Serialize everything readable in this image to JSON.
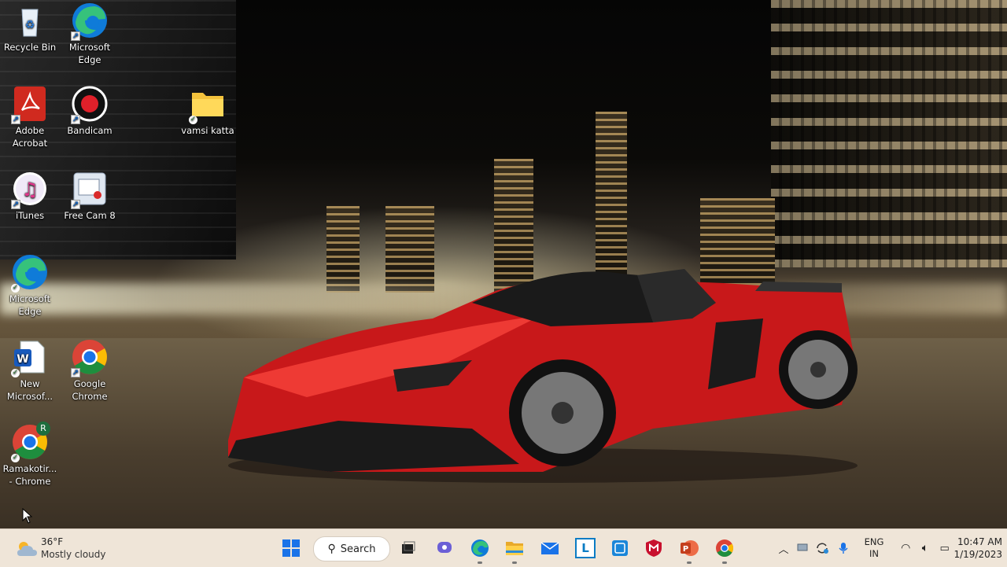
{
  "desktop": {
    "icons": [
      {
        "label": "Recycle Bin"
      },
      {
        "label": "Microsoft Edge"
      },
      {
        "label": "Adobe Acrobat"
      },
      {
        "label": "Bandicam"
      },
      {
        "label": "vamsi katta"
      },
      {
        "label": "iTunes"
      },
      {
        "label": "Free Cam 8"
      },
      {
        "label": "Microsoft Edge"
      },
      {
        "label": "New Microsof..."
      },
      {
        "label": "Google Chrome"
      },
      {
        "label": "Ramakotir... - Chrome"
      }
    ],
    "chrome_profile_badge": "R"
  },
  "taskbar": {
    "weather": {
      "temp": "36°F",
      "condition": "Mostly cloudy"
    },
    "search_label": "Search",
    "pinned": [
      "start-icon",
      "task-view-icon",
      "chat-icon",
      "edge-icon",
      "file-explorer-icon",
      "mail-icon",
      "lexicon-icon",
      "store-icon",
      "mcafee-icon",
      "powerpoint-icon",
      "chrome-icon"
    ],
    "pinned_letters": {
      "lexicon": "L"
    },
    "language": {
      "line1": "ENG",
      "line2": "IN"
    },
    "clock": {
      "time": "10:47 AM",
      "date": "1/19/2023"
    }
  },
  "colors": {
    "taskbar_bg": "#efe5d8",
    "car_red": "#d21e1e",
    "edge_blue": "#0f7bd8",
    "chrome_green": "#1e8e3e"
  }
}
